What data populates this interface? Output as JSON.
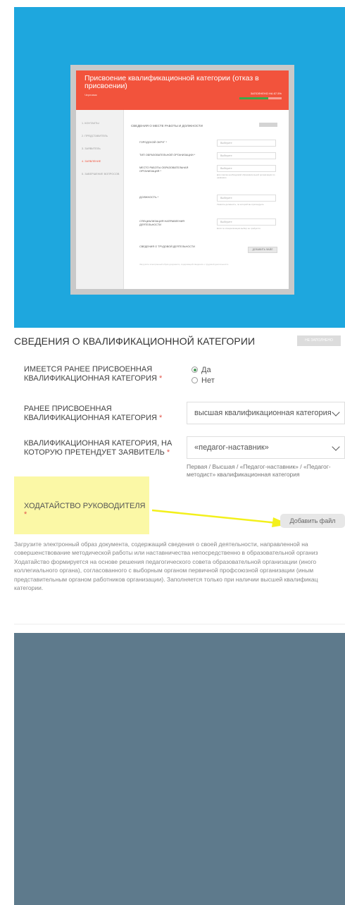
{
  "screenshot_preview": {
    "title": "Присвоение квалификационной категории (отказ в присвоении)",
    "subtitle": "Черновик",
    "status": "ЗАПОЛНЕНО НА 67.5%",
    "progress_fraction": 0.675,
    "sidebar_items": [
      {
        "label": "1. КОНТАКТЫ",
        "active": false
      },
      {
        "label": "2. ПРЕДСТАВИТЕЛЬ",
        "active": false
      },
      {
        "label": "3. ЗАЯВИТЕЛЬ",
        "active": false
      },
      {
        "label": "4. ЗАЯВЛЕНИЕ",
        "active": true
      },
      {
        "label": "5. ЗАВЕРШЕНИЕ ВОПРОСОВ",
        "active": false
      }
    ],
    "section_title": "СВЕДЕНИЯ О МЕСТЕ РАБОТЫ И ДОЛЖНОСТИ",
    "rows": [
      {
        "label": "ГОРОДСКОЙ ОКРУГ *",
        "value": "Выберите",
        "hint": ""
      },
      {
        "label": "ТИП ОБРАЗОВАТЕЛЬНОЙ ОРГАНИЗАЦИИ *",
        "value": "Выберите",
        "hint": ""
      },
      {
        "label": "МЕСТО РАБОТЫ ОБРАЗОВАТЕЛЬНАЯ ОРГАНИЗАЦИЯ *",
        "value": "Выберите",
        "hint": "Для поиска необходимой образовательной организации по названию"
      },
      {
        "label": "ДОЛЖНОСТЬ *",
        "value": "Выберите",
        "hint": "Укажите должность, по которой вы претендуете"
      },
      {
        "label": "СПЕЦИАЛИЗАЦИЯ НАПРАВЛЕНИЯ ДЕЯТЕЛЬНОСТИ",
        "value": "Выберите",
        "hint": "Если по специализации выбор не требуется"
      }
    ],
    "labor_label": "СВЕДЕНИЯ О ТРУДОВОЙ ДЕЯТЕЛЬНОСТИ",
    "add_file": "ДОБАВИТЬ ФАЙЛ",
    "footer_text": "Загрузите электронный образ документа, содержащий сведения о трудовой деятельности"
  },
  "form": {
    "section_title": "СВЕДЕНИЯ О КВАЛИФИКАЦИОННОЙ КАТЕГОРИИ",
    "badge": "НЕ ЗАПОЛНЕНО",
    "q1": {
      "label_line1": "ИМЕЕТСЯ РАНЕЕ ПРИСВОЕННАЯ",
      "label_line2": "КВАЛИФИКАЦИОННАЯ КАТЕГОРИЯ",
      "required": "*",
      "option_yes": "Да",
      "option_no": "Нет"
    },
    "q2": {
      "label_line1": "РАНЕЕ ПРИСВОЕННАЯ",
      "label_line2": "КВАЛИФИКАЦИОННАЯ КАТЕГОРИЯ",
      "required": "*",
      "value": "высшая квалификационная категория"
    },
    "q3": {
      "label_line1": "КВАЛИФИКАЦИОННАЯ КАТЕГОРИЯ, НА",
      "label_line2": "КОТОРУЮ ПРЕТЕНДУЕТ ЗАЯВИТЕЛЬ",
      "required": "*",
      "value": "«педагог-наставник»",
      "helper_line1": "Первая / Высшая / «Педагог-наставник» / «Педагог-",
      "helper_line2": "методист» квалификационная категория"
    },
    "q4": {
      "label": "ХОДАТАЙСТВО РУКОВОДИТЕЛЯ",
      "required": "*",
      "button": "Добавить файл"
    },
    "description_lines": [
      "Загрузите электронный образ документа, содержащий сведения о своей деятельности, направленной на",
      "совершенствование методической работы или наставничества непосредственно в образовательной организ",
      "Ходатайство формируется на основе решения педагогического совета образовательной организации (иного",
      "коллегиального органа), согласованного с выборным органом первичной профсоюзной организации (иным",
      "представительным органом работников организации). Заполняется только при наличии высшей квалификац",
      "категории."
    ]
  },
  "colors": {
    "blue_panel": "#1ea7de",
    "slate_panel": "#5e7a8c",
    "preview_header": "#f2533c",
    "highlight": "#fbf8a6",
    "arrow": "#f3f01c"
  }
}
